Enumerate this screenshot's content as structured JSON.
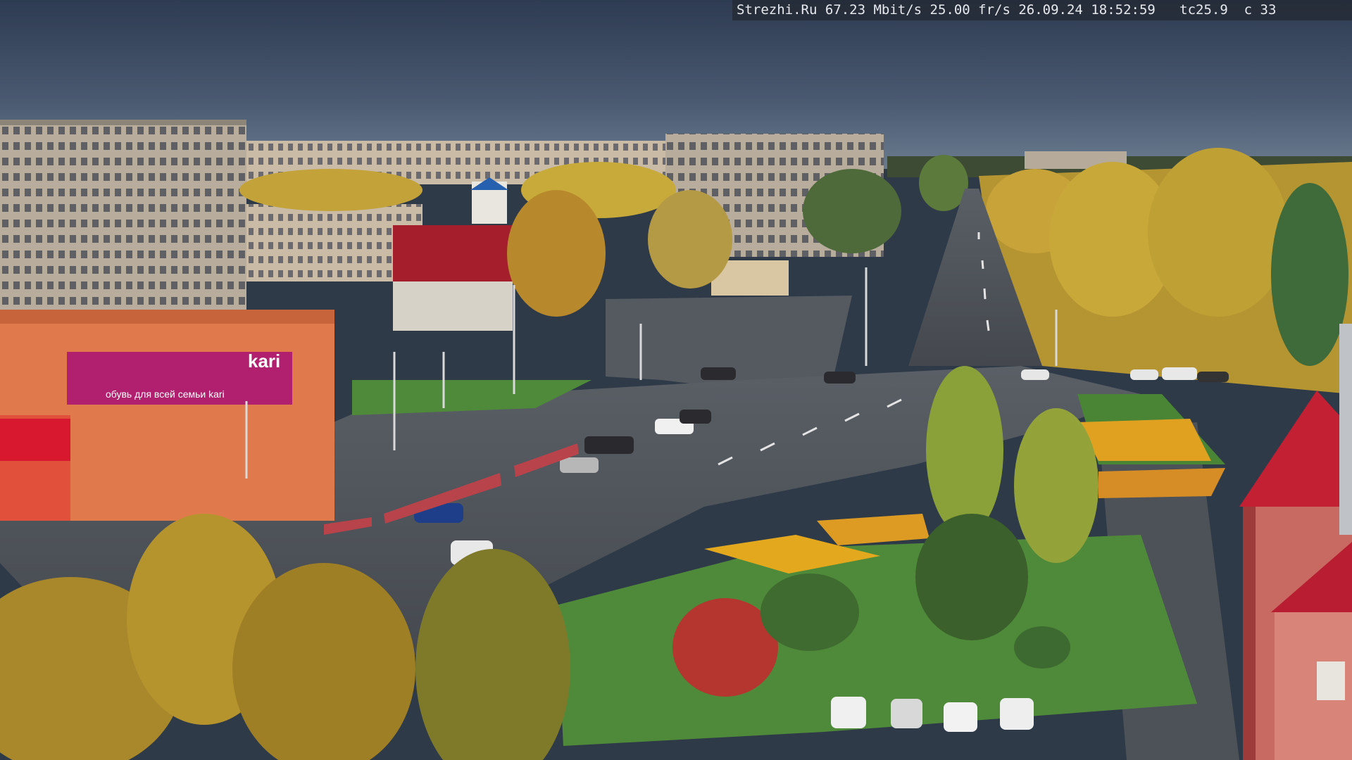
{
  "overlay": {
    "text": "Strezhi.Ru 67.23 Mbit/s 25.00 fr/s 26.09.24 18:52:59   tc25.9  c 33"
  },
  "signs": {
    "store_left": "kari",
    "store_banner": "обувь для всей семьи kari"
  },
  "colors": {
    "sky_top": "#34425a",
    "sky_bottom": "#5b6d83",
    "asphalt": "#4c5158",
    "grass": "#4f8a3a",
    "birch_yellow": "#c9a83a",
    "store_orange": "#e07a4c",
    "store_magenta": "#b0206e",
    "roof_red": "#c42034"
  }
}
